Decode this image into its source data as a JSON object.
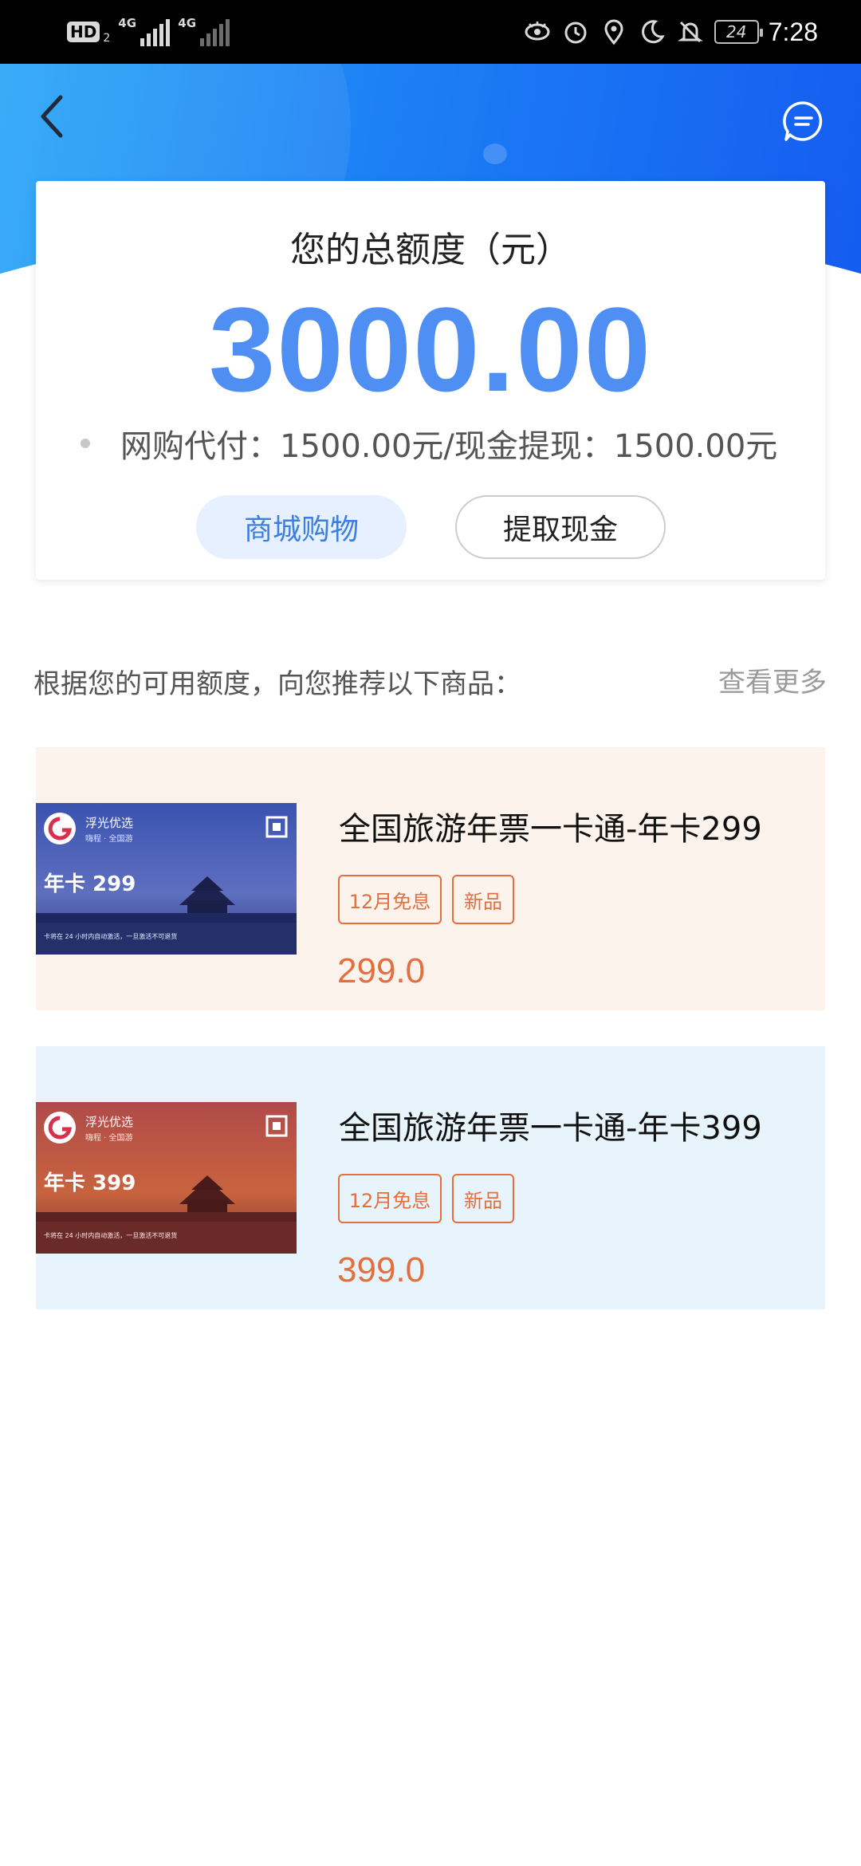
{
  "status_bar": {
    "hd_label": "HD",
    "hd_sub": "2",
    "net1": "4G",
    "net2": "4G",
    "battery": "24",
    "time": "7:28",
    "icons": [
      "eye-icon",
      "alarm-icon",
      "location-icon",
      "moon-icon",
      "bell-off-icon"
    ]
  },
  "header": {
    "back_icon": "chevron-left-icon",
    "message_icon": "message-icon"
  },
  "credit": {
    "title": "您的总额度（元）",
    "amount": "3000.00",
    "detail": "网购代付：1500.00元/现金提现：1500.00元",
    "shop_button": "商城购物",
    "cash_button": "提取现金"
  },
  "recommend": {
    "title": "根据您的可用额度，向您推荐以下商品：",
    "more": "查看更多"
  },
  "products": [
    {
      "name": "全国旅游年票一卡通-年卡299",
      "tags": [
        "12月免息",
        "新品"
      ],
      "price": "299.0",
      "card": {
        "brand": "浮光优选",
        "sub": "嗨程 · 全国游",
        "label": "年卡 299",
        "note": "卡将在 24 小时内自动激活，一旦激活不可退货"
      }
    },
    {
      "name": "全国旅游年票一卡通-年卡399",
      "tags": [
        "12月免息",
        "新品"
      ],
      "price": "399.0",
      "card": {
        "brand": "浮光优选",
        "sub": "嗨程 · 全国游",
        "label": "年卡 399",
        "note": "卡将在 24 小时内自动激活，一旦激活不可退货"
      }
    }
  ],
  "colors": {
    "accent_blue": "#4f8ff3",
    "price_orange": "#e36f3f",
    "product1_bg": "#fcf4ec",
    "product2_bg": "#e8f4fc"
  }
}
